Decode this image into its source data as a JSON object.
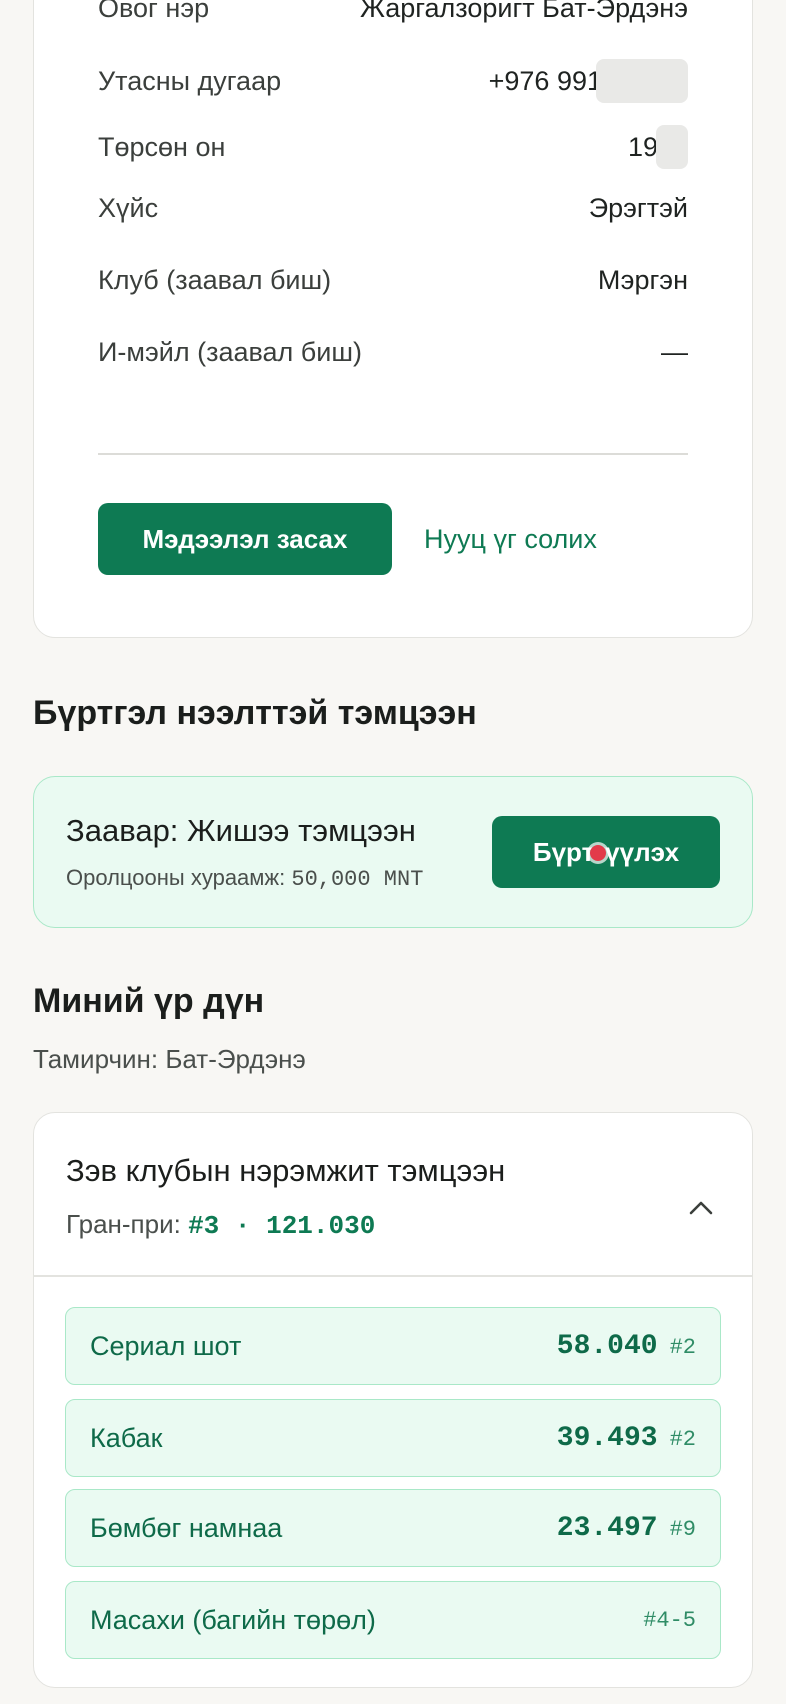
{
  "profile": {
    "rows": [
      {
        "label": "Овог нэр",
        "value": "Жаргалзоригт Бат-Эрдэнэ"
      },
      {
        "label": "Утасны дугаар",
        "value": "+976 991"
      },
      {
        "label": "Төрсөн он",
        "value": "19"
      },
      {
        "label": "Хүйс",
        "value": "Эрэгтэй"
      },
      {
        "label": "Клуб (заавал биш)",
        "value": "Мэргэн"
      },
      {
        "label": "И-мэйл (заавал биш)",
        "value": "—"
      }
    ],
    "edit_button": "Мэдээлэл засах",
    "change_password": "Нууц үг солих"
  },
  "open_registration": {
    "title": "Бүртгэл нээлттэй тэмцээн",
    "competition_name": "Заавар: Жишээ тэмцээн",
    "fee_label": "Оролцооны хураамж:",
    "fee_value": "50,000 MNT",
    "register_button": "Бүртгүүлэх"
  },
  "my_results": {
    "title": "Миний үр дүн",
    "athlete": "Тамирчин: Бат-Эрдэнэ",
    "competition": {
      "name": "Зэв клубын нэрэмжит тэмцээн",
      "grand_prix_label": "Гран-при:",
      "grand_prix_value": "#3 · 121.030",
      "expanded": true,
      "events": [
        {
          "name": "Сериал шот",
          "score": "58.040",
          "rank": "#2"
        },
        {
          "name": "Кабак",
          "score": "39.493",
          "rank": "#2"
        },
        {
          "name": "Бөмбөг намнаа",
          "score": "23.497",
          "rank": "#9"
        },
        {
          "name": "Масахи (багийн төрөл)",
          "score": "",
          "rank": "#4-5"
        }
      ]
    }
  },
  "colors": {
    "accent": "#0e7a53",
    "mint_bg": "#eafaf2",
    "mint_border": "#a9e8c8"
  }
}
